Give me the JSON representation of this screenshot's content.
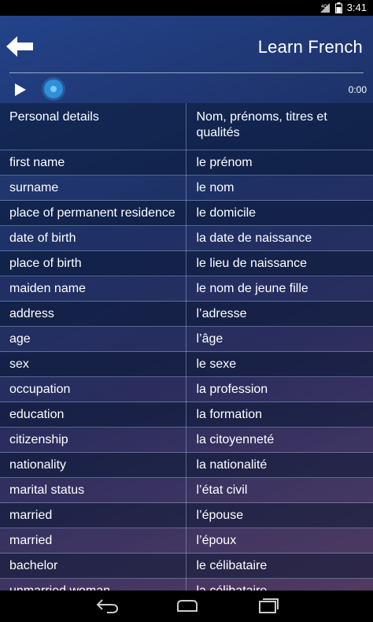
{
  "status_bar": {
    "time": "3:41"
  },
  "header": {
    "title": "Learn French"
  },
  "player": {
    "time": "0:00"
  },
  "table": {
    "header": {
      "english": "Personal details",
      "french": "Nom, prénoms, titres et qualités"
    },
    "rows": [
      {
        "english": "first name",
        "french": "le prénom"
      },
      {
        "english": "surname",
        "french": "le nom"
      },
      {
        "english": "place of permanent residence",
        "french": "le domicile"
      },
      {
        "english": "date of birth",
        "french": "la date de naissance"
      },
      {
        "english": "place of birth",
        "french": "le lieu de naissance"
      },
      {
        "english": "maiden name",
        "french": "le nom de jeune fille"
      },
      {
        "english": "address",
        "french": "l’adresse"
      },
      {
        "english": "age",
        "french": "l’âge"
      },
      {
        "english": "sex",
        "french": "le sexe"
      },
      {
        "english": "occupation",
        "french": "la profession"
      },
      {
        "english": "education",
        "french": "la formation"
      },
      {
        "english": "citizenship",
        "french": "la citoyenneté"
      },
      {
        "english": "nationality",
        "french": "la nationalité"
      },
      {
        "english": "marital status",
        "french": "l’état civil"
      },
      {
        "english": "married",
        "french": "l’épouse"
      },
      {
        "english": "married",
        "french": "l’époux"
      },
      {
        "english": "bachelor",
        "french": "le célibataire"
      },
      {
        "english": "unmarried woman",
        "french": "la célibataire"
      }
    ]
  },
  "icons": {
    "back": "arrow-left-icon",
    "play": "play-icon",
    "nav_back": "nav-back-icon",
    "nav_home": "nav-home-icon",
    "nav_recents": "nav-recents-icon"
  },
  "colors": {
    "accent": "#2f8fd8"
  }
}
